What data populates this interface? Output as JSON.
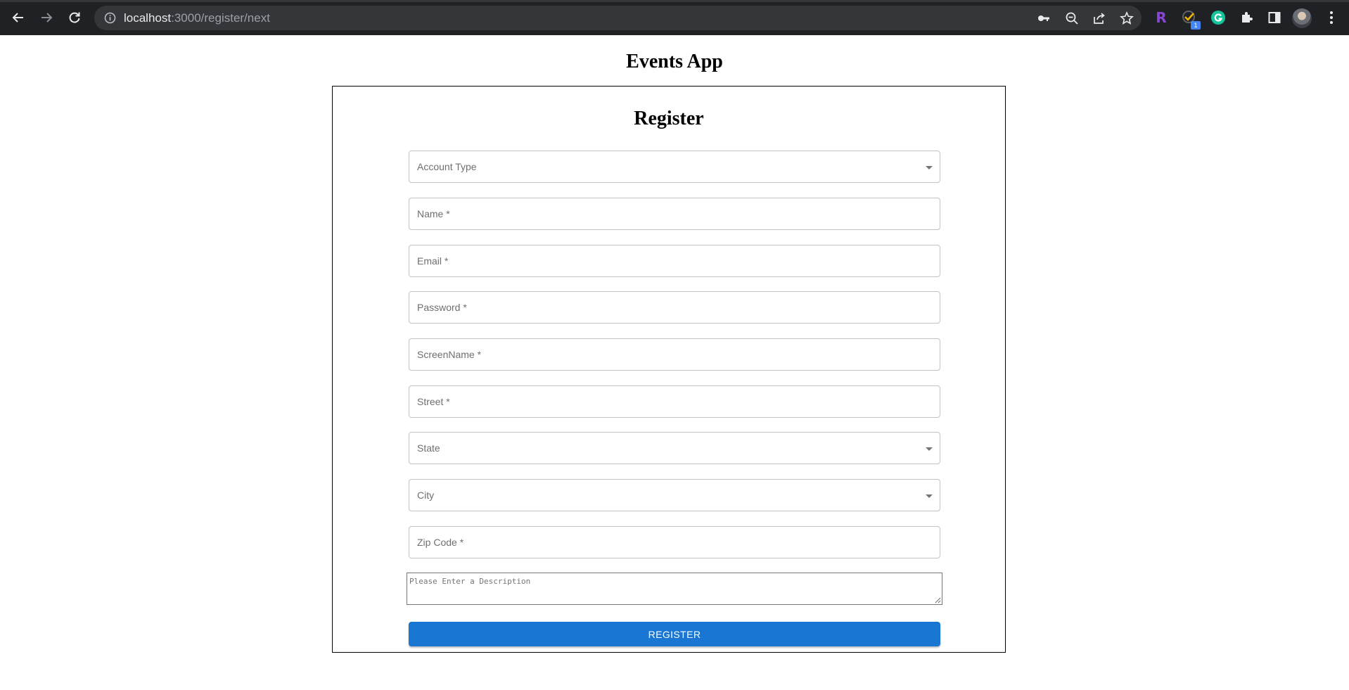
{
  "browser": {
    "url_host": "localhost",
    "url_path": ":3000/register/next",
    "extension_badge": "1"
  },
  "page": {
    "app_title": "Events App",
    "form_title": "Register"
  },
  "form": {
    "account_type": {
      "label": "Account Type"
    },
    "name": {
      "label": "Name *"
    },
    "email": {
      "label": "Email *"
    },
    "password": {
      "label": "Password *"
    },
    "screen_name": {
      "label": "ScreenName *"
    },
    "street": {
      "label": "Street *"
    },
    "state": {
      "label": "State"
    },
    "city": {
      "label": "City"
    },
    "zip_code": {
      "label": "Zip Code *"
    },
    "description": {
      "placeholder": "Please Enter a Description"
    },
    "submit_label": "REGISTER"
  },
  "colors": {
    "chrome_bg": "#202124",
    "omnibox_bg": "#35363a",
    "primary_button": "#1976d2"
  }
}
